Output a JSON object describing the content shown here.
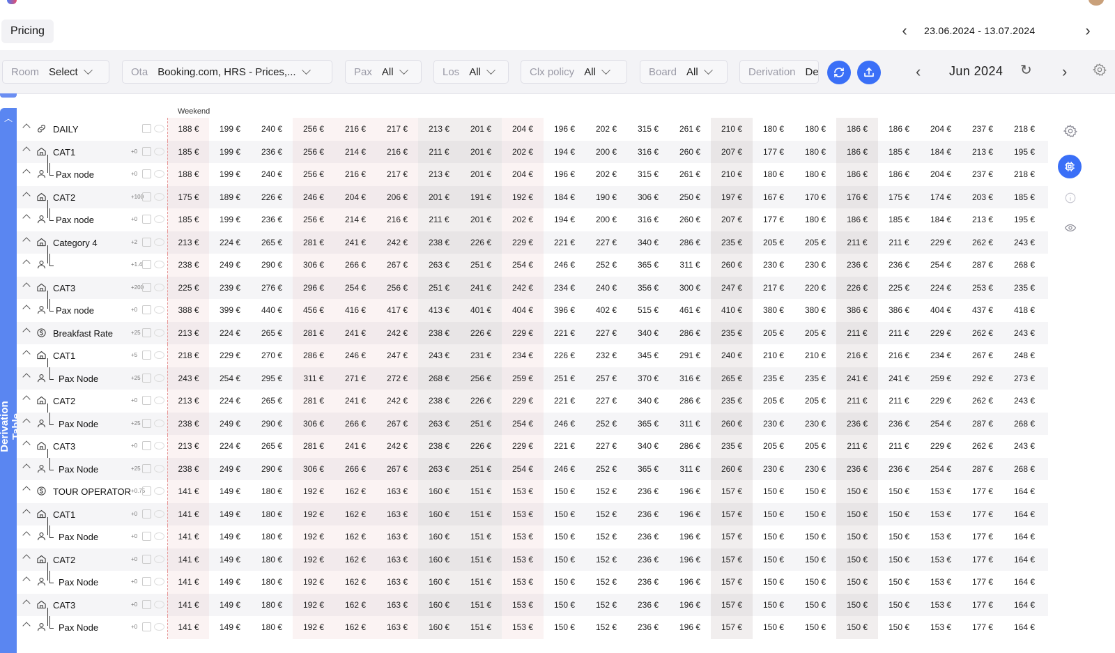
{
  "page": {
    "tab": "Pricing",
    "date_range": "23.06.2024 - 13.07.2024"
  },
  "filters": {
    "room": {
      "label": "Room",
      "value": "Select"
    },
    "ota": {
      "label": "Ota",
      "value": "Booking.com, HRS - Prices,..."
    },
    "pax": {
      "label": "Pax",
      "value": "All"
    },
    "los": {
      "label": "Los",
      "value": "All"
    },
    "clx": {
      "label": "Clx policy",
      "value": "All"
    },
    "board": {
      "label": "Board",
      "value": "All"
    },
    "derivation": {
      "label": "Derivation",
      "value": "De"
    }
  },
  "month": "Jun 2024",
  "side_tab": "Derivation Table",
  "weekend_label": "Weekend",
  "colors": {
    "accent": "#3a6ff7",
    "sidetab": "#5a86f1",
    "weekend_tint": "#f9ecec"
  },
  "column_shading": [
    "we",
    "w",
    "w",
    "we",
    "we",
    "we",
    "dk",
    "dk",
    "we",
    "w",
    "w",
    "w",
    "w",
    "dk",
    "w",
    "w",
    "dk",
    "w",
    "w",
    "w",
    "w"
  ],
  "rows": [
    {
      "icon": "link",
      "label": "DAILY",
      "diff": "",
      "level": 0,
      "values": [
        "188 €",
        "199 €",
        "240 €",
        "256 €",
        "216 €",
        "217 €",
        "213 €",
        "201 €",
        "204 €",
        "196 €",
        "202 €",
        "315 €",
        "261 €",
        "210 €",
        "180 €",
        "180 €",
        "186 €",
        "186 €",
        "204 €",
        "237 €",
        "218 €"
      ]
    },
    {
      "icon": "room",
      "label": "CAT1",
      "diff": "+0",
      "level": 1,
      "values": [
        "185 €",
        "199 €",
        "236 €",
        "256 €",
        "214 €",
        "216 €",
        "211 €",
        "201 €",
        "202 €",
        "194 €",
        "200 €",
        "316 €",
        "260 €",
        "207 €",
        "177 €",
        "180 €",
        "186 €",
        "185 €",
        "184 €",
        "213 €",
        "195 €"
      ]
    },
    {
      "icon": "person",
      "label": "Pax node",
      "diff": "+0",
      "level": 2,
      "values": [
        "188 €",
        "199 €",
        "240 €",
        "256 €",
        "216 €",
        "217 €",
        "213 €",
        "201 €",
        "204 €",
        "196 €",
        "202 €",
        "315 €",
        "261 €",
        "210 €",
        "180 €",
        "180 €",
        "186 €",
        "186 €",
        "204 €",
        "237 €",
        "218 €"
      ]
    },
    {
      "icon": "room",
      "label": "CAT2",
      "diff": "+100",
      "level": 1,
      "values": [
        "175 €",
        "189 €",
        "226 €",
        "246 €",
        "204 €",
        "206 €",
        "201 €",
        "191 €",
        "192 €",
        "184 €",
        "190 €",
        "306 €",
        "250 €",
        "197 €",
        "167 €",
        "170 €",
        "176 €",
        "175 €",
        "174 €",
        "203 €",
        "185 €"
      ]
    },
    {
      "icon": "person",
      "label": "Pax node",
      "diff": "+0",
      "level": 2,
      "values": [
        "185 €",
        "199 €",
        "236 €",
        "256 €",
        "214 €",
        "216 €",
        "211 €",
        "201 €",
        "202 €",
        "194 €",
        "200 €",
        "316 €",
        "260 €",
        "207 €",
        "177 €",
        "180 €",
        "186 €",
        "185 €",
        "184 €",
        "213 €",
        "195 €"
      ]
    },
    {
      "icon": "room",
      "label": "Category 4",
      "diff": "+2",
      "level": 1,
      "values": [
        "213 €",
        "224 €",
        "265 €",
        "281 €",
        "241 €",
        "242 €",
        "238 €",
        "226 €",
        "229 €",
        "221 €",
        "227 €",
        "340 €",
        "286 €",
        "235 €",
        "205 €",
        "205 €",
        "211 €",
        "211 €",
        "229 €",
        "262 €",
        "243 €"
      ]
    },
    {
      "icon": "person",
      "label": "",
      "diff": "+1.4",
      "level": 2,
      "values": [
        "238 €",
        "249 €",
        "290 €",
        "306 €",
        "266 €",
        "267 €",
        "263 €",
        "251 €",
        "254 €",
        "246 €",
        "252 €",
        "365 €",
        "311 €",
        "260 €",
        "230 €",
        "230 €",
        "236 €",
        "236 €",
        "254 €",
        "287 €",
        "268 €"
      ]
    },
    {
      "icon": "room",
      "label": "CAT3",
      "diff": "+200",
      "level": 1,
      "values": [
        "225 €",
        "239 €",
        "276 €",
        "296 €",
        "254 €",
        "256 €",
        "251 €",
        "241 €",
        "242 €",
        "234 €",
        "240 €",
        "356 €",
        "300 €",
        "247 €",
        "217 €",
        "220 €",
        "226 €",
        "225 €",
        "224 €",
        "253 €",
        "235 €"
      ]
    },
    {
      "icon": "person",
      "label": "Pax node",
      "diff": "+0",
      "level": 2,
      "values": [
        "388 €",
        "399 €",
        "440 €",
        "456 €",
        "416 €",
        "417 €",
        "413 €",
        "401 €",
        "404 €",
        "396 €",
        "402 €",
        "515 €",
        "461 €",
        "410 €",
        "380 €",
        "380 €",
        "386 €",
        "386 €",
        "404 €",
        "437 €",
        "418 €"
      ]
    },
    {
      "icon": "rate",
      "label": "Breakfast Rate",
      "diff": "+25",
      "level": 0,
      "values": [
        "213 €",
        "224 €",
        "265 €",
        "281 €",
        "241 €",
        "242 €",
        "238 €",
        "226 €",
        "229 €",
        "221 €",
        "227 €",
        "340 €",
        "286 €",
        "235 €",
        "205 €",
        "205 €",
        "211 €",
        "211 €",
        "229 €",
        "262 €",
        "243 €"
      ]
    },
    {
      "icon": "room",
      "label": "CAT1",
      "diff": "+5",
      "level": 1,
      "values": [
        "218 €",
        "229 €",
        "270 €",
        "286 €",
        "246 €",
        "247 €",
        "243 €",
        "231 €",
        "234 €",
        "226 €",
        "232 €",
        "345 €",
        "291 €",
        "240 €",
        "210 €",
        "210 €",
        "216 €",
        "216 €",
        "234 €",
        "267 €",
        "248 €"
      ]
    },
    {
      "icon": "person",
      "label": "Pax Node",
      "diff": "+25",
      "level": 2,
      "values": [
        "243 €",
        "254 €",
        "295 €",
        "311 €",
        "271 €",
        "272 €",
        "268 €",
        "256 €",
        "259 €",
        "251 €",
        "257 €",
        "370 €",
        "316 €",
        "265 €",
        "235 €",
        "235 €",
        "241 €",
        "241 €",
        "259 €",
        "292 €",
        "273 €"
      ]
    },
    {
      "icon": "room",
      "label": "CAT2",
      "diff": "+0",
      "level": 1,
      "values": [
        "213 €",
        "224 €",
        "265 €",
        "281 €",
        "241 €",
        "242 €",
        "238 €",
        "226 €",
        "229 €",
        "221 €",
        "227 €",
        "340 €",
        "286 €",
        "235 €",
        "205 €",
        "205 €",
        "211 €",
        "211 €",
        "229 €",
        "262 €",
        "243 €"
      ]
    },
    {
      "icon": "person",
      "label": "Pax Node",
      "diff": "+25",
      "level": 2,
      "values": [
        "238 €",
        "249 €",
        "290 €",
        "306 €",
        "266 €",
        "267 €",
        "263 €",
        "251 €",
        "254 €",
        "246 €",
        "252 €",
        "365 €",
        "311 €",
        "260 €",
        "230 €",
        "230 €",
        "236 €",
        "236 €",
        "254 €",
        "287 €",
        "268 €"
      ]
    },
    {
      "icon": "room",
      "label": "CAT3",
      "diff": "+0",
      "level": 1,
      "values": [
        "213 €",
        "224 €",
        "265 €",
        "281 €",
        "241 €",
        "242 €",
        "238 €",
        "226 €",
        "229 €",
        "221 €",
        "227 €",
        "340 €",
        "286 €",
        "235 €",
        "205 €",
        "205 €",
        "211 €",
        "211 €",
        "229 €",
        "262 €",
        "243 €"
      ]
    },
    {
      "icon": "person",
      "label": "Pax Node",
      "diff": "+25",
      "level": 2,
      "values": [
        "238 €",
        "249 €",
        "290 €",
        "306 €",
        "266 €",
        "267 €",
        "263 €",
        "251 €",
        "254 €",
        "246 €",
        "252 €",
        "365 €",
        "311 €",
        "260 €",
        "230 €",
        "230 €",
        "236 €",
        "236 €",
        "254 €",
        "287 €",
        "268 €"
      ]
    },
    {
      "icon": "rate",
      "label": "TOUR OPERATOR",
      "diff": "+0.75",
      "level": 0,
      "values": [
        "141 €",
        "149 €",
        "180 €",
        "192 €",
        "162 €",
        "163 €",
        "160 €",
        "151 €",
        "153 €",
        "150 €",
        "152 €",
        "236 €",
        "196 €",
        "157 €",
        "150 €",
        "150 €",
        "150 €",
        "150 €",
        "153 €",
        "177 €",
        "164 €"
      ]
    },
    {
      "icon": "room",
      "label": "CAT1",
      "diff": "+0",
      "level": 1,
      "values": [
        "141 €",
        "149 €",
        "180 €",
        "192 €",
        "162 €",
        "163 €",
        "160 €",
        "151 €",
        "153 €",
        "150 €",
        "152 €",
        "236 €",
        "196 €",
        "157 €",
        "150 €",
        "150 €",
        "150 €",
        "150 €",
        "153 €",
        "177 €",
        "164 €"
      ]
    },
    {
      "icon": "person",
      "label": "Pax Node",
      "diff": "+0",
      "level": 2,
      "values": [
        "141 €",
        "149 €",
        "180 €",
        "192 €",
        "162 €",
        "163 €",
        "160 €",
        "151 €",
        "153 €",
        "150 €",
        "152 €",
        "236 €",
        "196 €",
        "157 €",
        "150 €",
        "150 €",
        "150 €",
        "150 €",
        "153 €",
        "177 €",
        "164 €"
      ]
    },
    {
      "icon": "room",
      "label": "CAT2",
      "diff": "+0",
      "level": 1,
      "values": [
        "141 €",
        "149 €",
        "180 €",
        "192 €",
        "162 €",
        "163 €",
        "160 €",
        "151 €",
        "153 €",
        "150 €",
        "152 €",
        "236 €",
        "196 €",
        "157 €",
        "150 €",
        "150 €",
        "150 €",
        "150 €",
        "153 €",
        "177 €",
        "164 €"
      ]
    },
    {
      "icon": "person",
      "label": "Pax Node",
      "diff": "+0",
      "level": 2,
      "values": [
        "141 €",
        "149 €",
        "180 €",
        "192 €",
        "162 €",
        "163 €",
        "160 €",
        "151 €",
        "153 €",
        "150 €",
        "152 €",
        "236 €",
        "196 €",
        "157 €",
        "150 €",
        "150 €",
        "150 €",
        "150 €",
        "153 €",
        "177 €",
        "164 €"
      ]
    },
    {
      "icon": "room",
      "label": "CAT3",
      "diff": "+0",
      "level": 1,
      "values": [
        "141 €",
        "149 €",
        "180 €",
        "192 €",
        "162 €",
        "163 €",
        "160 €",
        "151 €",
        "153 €",
        "150 €",
        "152 €",
        "236 €",
        "196 €",
        "157 €",
        "150 €",
        "150 €",
        "150 €",
        "150 €",
        "153 €",
        "177 €",
        "164 €"
      ]
    },
    {
      "icon": "person",
      "label": "Pax Node",
      "diff": "+0",
      "level": 2,
      "values": [
        "141 €",
        "149 €",
        "180 €",
        "192 €",
        "162 €",
        "163 €",
        "160 €",
        "151 €",
        "153 €",
        "150 €",
        "152 €",
        "236 €",
        "196 €",
        "157 €",
        "150 €",
        "150 €",
        "150 €",
        "150 €",
        "153 €",
        "177 €",
        "164 €"
      ]
    }
  ]
}
